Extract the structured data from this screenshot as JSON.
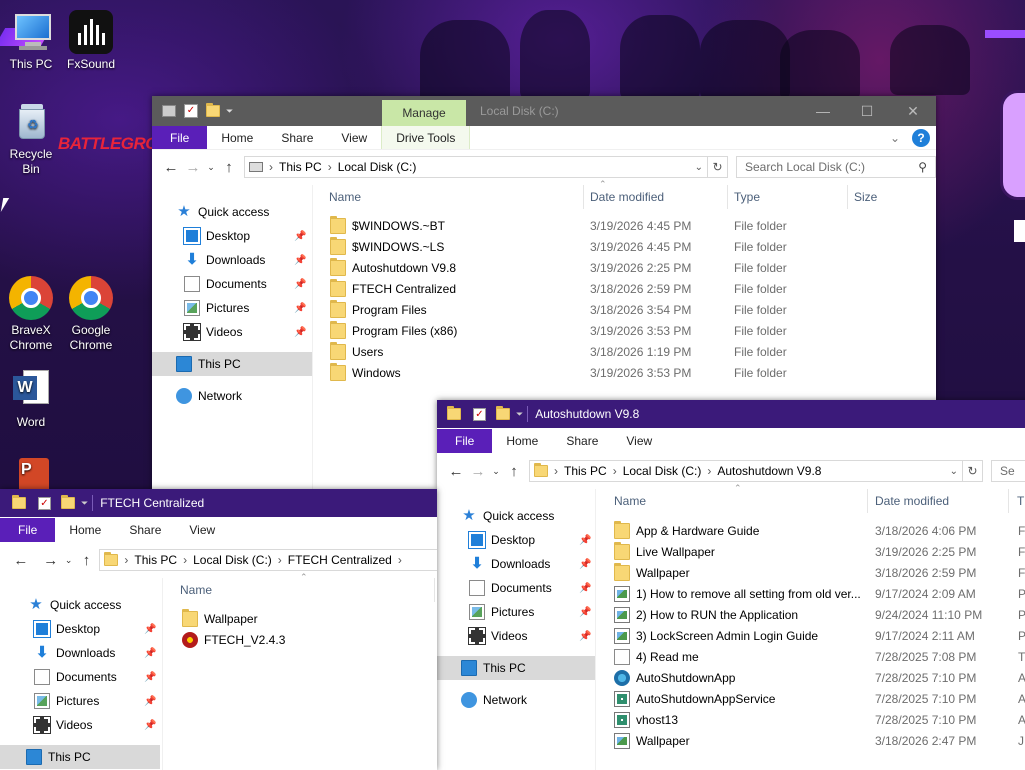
{
  "desktop": {
    "icons": [
      {
        "label": "This PC",
        "icon": "monitor-icon"
      },
      {
        "label": "FxSound",
        "icon": "fxsound-icon"
      },
      {
        "label": "Recycle Bin",
        "icon": "recycle-bin-icon"
      },
      {
        "label": "BraveX Chrome",
        "icon": "chrome-icon"
      },
      {
        "label": "Google Chrome",
        "icon": "chrome-icon"
      },
      {
        "label": "Word",
        "icon": "word-icon"
      },
      {
        "label": "",
        "icon": "powerpoint-icon"
      }
    ],
    "wallpaper_text": "BATTLEGROUNDS"
  },
  "win_c": {
    "manage_tab": "Manage",
    "title": "Local Disk (C:)",
    "ribbon": [
      "File",
      "Home",
      "Share",
      "View",
      "Drive Tools"
    ],
    "path": [
      "This PC",
      "Local Disk (C:)"
    ],
    "search_placeholder": "Search Local Disk (C:)",
    "columns": {
      "name": "Name",
      "date": "Date modified",
      "type": "Type",
      "size": "Size"
    },
    "nav": {
      "quick_access": "Quick access",
      "items": [
        "Desktop",
        "Downloads",
        "Documents",
        "Pictures",
        "Videos"
      ],
      "this_pc": "This PC",
      "network": "Network"
    },
    "files": [
      {
        "name": "$WINDOWS.~BT",
        "date": "3/19/2026 4:45 PM",
        "type": "File folder"
      },
      {
        "name": "$WINDOWS.~LS",
        "date": "3/19/2026 4:45 PM",
        "type": "File folder"
      },
      {
        "name": "Autoshutdown V9.8",
        "date": "3/19/2026 2:25 PM",
        "type": "File folder"
      },
      {
        "name": "FTECH Centralized",
        "date": "3/18/2026 2:59 PM",
        "type": "File folder"
      },
      {
        "name": "Program Files",
        "date": "3/18/2026 3:54 PM",
        "type": "File folder"
      },
      {
        "name": "Program Files (x86)",
        "date": "3/19/2026 3:53 PM",
        "type": "File folder"
      },
      {
        "name": "Users",
        "date": "3/18/2026 1:19 PM",
        "type": "File folder"
      },
      {
        "name": "Windows",
        "date": "3/19/2026 3:53 PM",
        "type": "File folder"
      }
    ]
  },
  "win_auto": {
    "title": "Autoshutdown V9.8",
    "ribbon": [
      "File",
      "Home",
      "Share",
      "View"
    ],
    "path": [
      "This PC",
      "Local Disk (C:)",
      "Autoshutdown V9.8"
    ],
    "search_placeholder": "Se",
    "columns": {
      "name": "Name",
      "date": "Date modified",
      "type": "T"
    },
    "nav": {
      "quick_access": "Quick access",
      "items": [
        "Desktop",
        "Downloads",
        "Documents",
        "Pictures",
        "Videos"
      ],
      "this_pc": "This PC",
      "network": "Network"
    },
    "files": [
      {
        "name": "App & Hardware Guide",
        "date": "3/18/2026 4:06 PM",
        "type": "F",
        "kind": "folder"
      },
      {
        "name": "Live Wallpaper",
        "date": "3/19/2026 2:25 PM",
        "type": "F",
        "kind": "folder"
      },
      {
        "name": "Wallpaper",
        "date": "3/18/2026 2:59 PM",
        "type": "F",
        "kind": "folder"
      },
      {
        "name": "1) How to remove all setting from old ver...",
        "date": "9/17/2024 2:09 AM",
        "type": "P",
        "kind": "image"
      },
      {
        "name": "2) How to RUN the Application",
        "date": "9/24/2024 11:10 PM",
        "type": "P",
        "kind": "image"
      },
      {
        "name": "3) LockScreen Admin Login Guide",
        "date": "9/17/2024 2:11 AM",
        "type": "P",
        "kind": "image"
      },
      {
        "name": "4) Read me",
        "date": "7/28/2025 7:08 PM",
        "type": "T",
        "kind": "text"
      },
      {
        "name": "AutoShutdownApp",
        "date": "7/28/2025 7:10 PM",
        "type": "A",
        "kind": "app"
      },
      {
        "name": "AutoShutdownAppService",
        "date": "7/28/2025 7:10 PM",
        "type": "A",
        "kind": "service"
      },
      {
        "name": "vhost13",
        "date": "7/28/2025 7:10 PM",
        "type": "A",
        "kind": "service"
      },
      {
        "name": "Wallpaper",
        "date": "3/18/2026 2:47 PM",
        "type": "JI",
        "kind": "image"
      }
    ]
  },
  "win_ftech": {
    "title": "FTECH Centralized",
    "ribbon": [
      "File",
      "Home",
      "Share",
      "View"
    ],
    "path": [
      "This PC",
      "Local Disk (C:)",
      "FTECH Centralized"
    ],
    "columns": {
      "name": "Name"
    },
    "nav": {
      "quick_access": "Quick access",
      "items": [
        "Desktop",
        "Downloads",
        "Documents",
        "Pictures",
        "Videos"
      ],
      "this_pc": "This PC"
    },
    "files": [
      {
        "name": "Wallpaper",
        "kind": "folder"
      },
      {
        "name": "FTECH_V2.4.3",
        "kind": "app"
      }
    ]
  },
  "colors": {
    "accent": "#5a1fb8",
    "title_dark": "#3b1a7a",
    "manage_tab": "#c9e7a7",
    "selected": "#d9d9d9"
  }
}
